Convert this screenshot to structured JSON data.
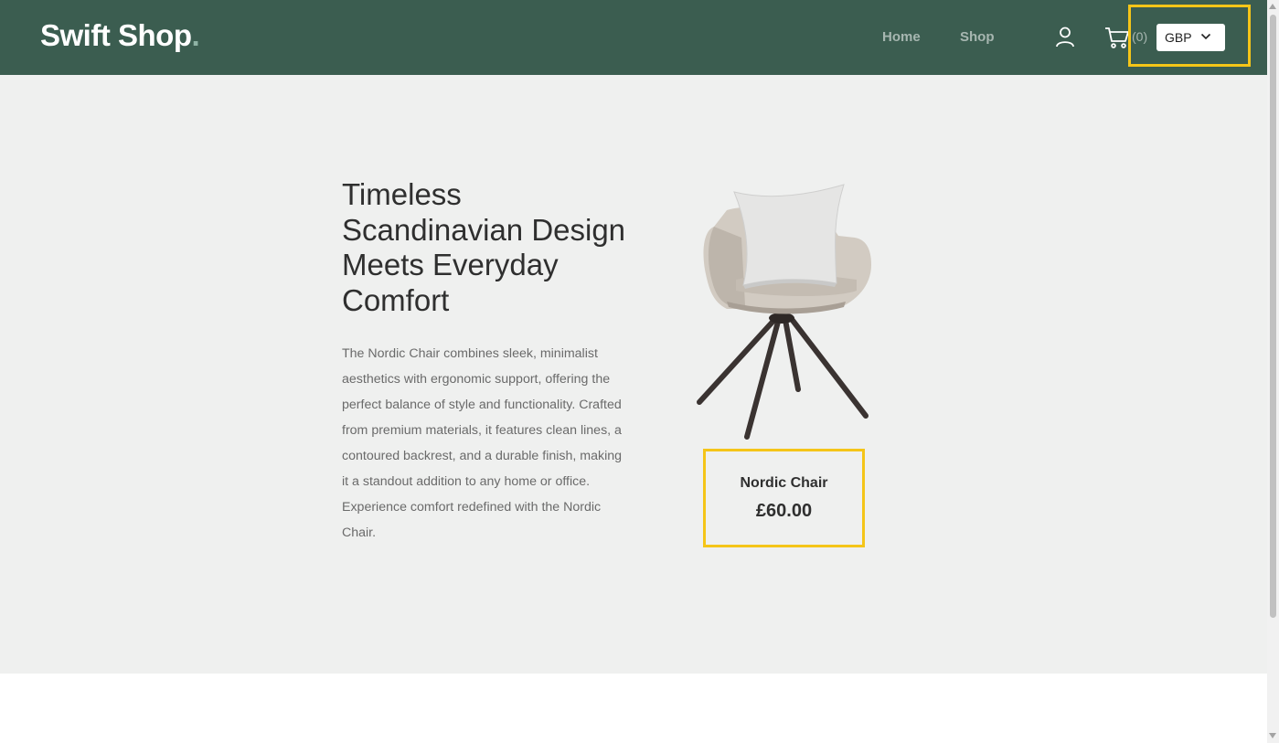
{
  "header": {
    "logo_text": "Swift Shop",
    "logo_dot": ".",
    "nav": [
      {
        "label": "Home"
      },
      {
        "label": "Shop"
      }
    ],
    "cart_count": "(0)",
    "currency": {
      "selected": "GBP"
    }
  },
  "hero": {
    "title": "Timeless Scandinavian Design Meets Everyday Comfort",
    "description": "The Nordic Chair combines sleek, minimalist aesthetics with ergonomic support, offering the perfect balance of style and functionality. Crafted from premium materials, it features clean lines, a contoured backrest, and a durable finish, making it a standout addition to any home or office. Experience comfort redefined with the Nordic Chair.",
    "product": {
      "name": "Nordic Chair",
      "price": "£60.00"
    }
  },
  "colors": {
    "header_bg": "#3b5d50",
    "hero_bg": "#eff0ef",
    "highlight": "#f5c518",
    "text_dark": "#2f2f2f"
  },
  "icons": [
    "user-icon",
    "cart-icon",
    "chevron-down-icon",
    "chair-image"
  ]
}
